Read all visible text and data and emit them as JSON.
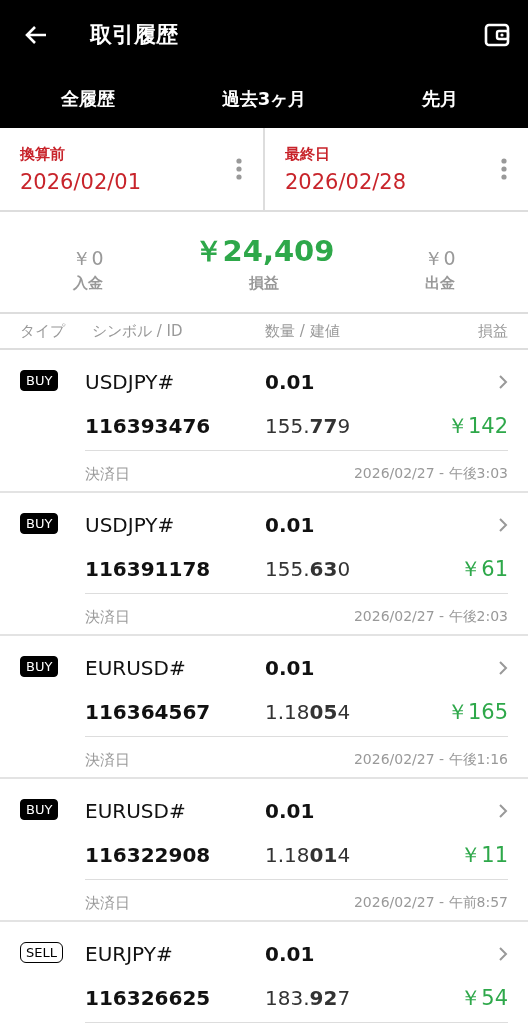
{
  "app_bar": {
    "title": "取引履歴"
  },
  "tabs": [
    {
      "label": "全履歴"
    },
    {
      "label": "過去3ヶ月"
    },
    {
      "label": "先月"
    }
  ],
  "date_range": [
    {
      "label": "換算前",
      "value": "2026/02/01"
    },
    {
      "label": "最終日",
      "value": "2026/02/28"
    }
  ],
  "summary": [
    {
      "amount": "￥0",
      "label": "入金",
      "kind": "side"
    },
    {
      "amount": "￥24,409",
      "label": "損益",
      "kind": "main"
    },
    {
      "amount": "￥0",
      "label": "出金",
      "kind": "side"
    }
  ],
  "columns": [
    "タイプ",
    "シンボル / ID",
    "数量 / 建値",
    "損益"
  ],
  "trades": [
    {
      "side": "BUY",
      "kind": "buy",
      "symbol": "USDJPY#",
      "volume": "0.01",
      "id": "116393476",
      "price": "155.**77**9",
      "profit": "￥142",
      "settle_label": "決済日",
      "settle_time": "2026/02/27 - 午後3:03"
    },
    {
      "side": "BUY",
      "kind": "buy",
      "symbol": "USDJPY#",
      "volume": "0.01",
      "id": "116391178",
      "price": "155.**63**0",
      "profit": "￥61",
      "settle_label": "決済日",
      "settle_time": "2026/02/27 - 午後2:03"
    },
    {
      "side": "BUY",
      "kind": "buy",
      "symbol": "EURUSD#",
      "volume": "0.01",
      "id": "116364567",
      "price": "1.18**05**4",
      "profit": "￥165",
      "settle_label": "決済日",
      "settle_time": "2026/02/27 - 午後1:16"
    },
    {
      "side": "BUY",
      "kind": "buy",
      "symbol": "EURUSD#",
      "volume": "0.01",
      "id": "116322908",
      "price": "1.18**01**4",
      "profit": "￥11",
      "settle_label": "決済日",
      "settle_time": "2026/02/27 - 午前8:57"
    },
    {
      "side": "SELL",
      "kind": "sell",
      "symbol": "EURJPY#",
      "volume": "0.01",
      "id": "116326625",
      "price": "183.**92**7",
      "profit": "￥54"
    }
  ]
}
